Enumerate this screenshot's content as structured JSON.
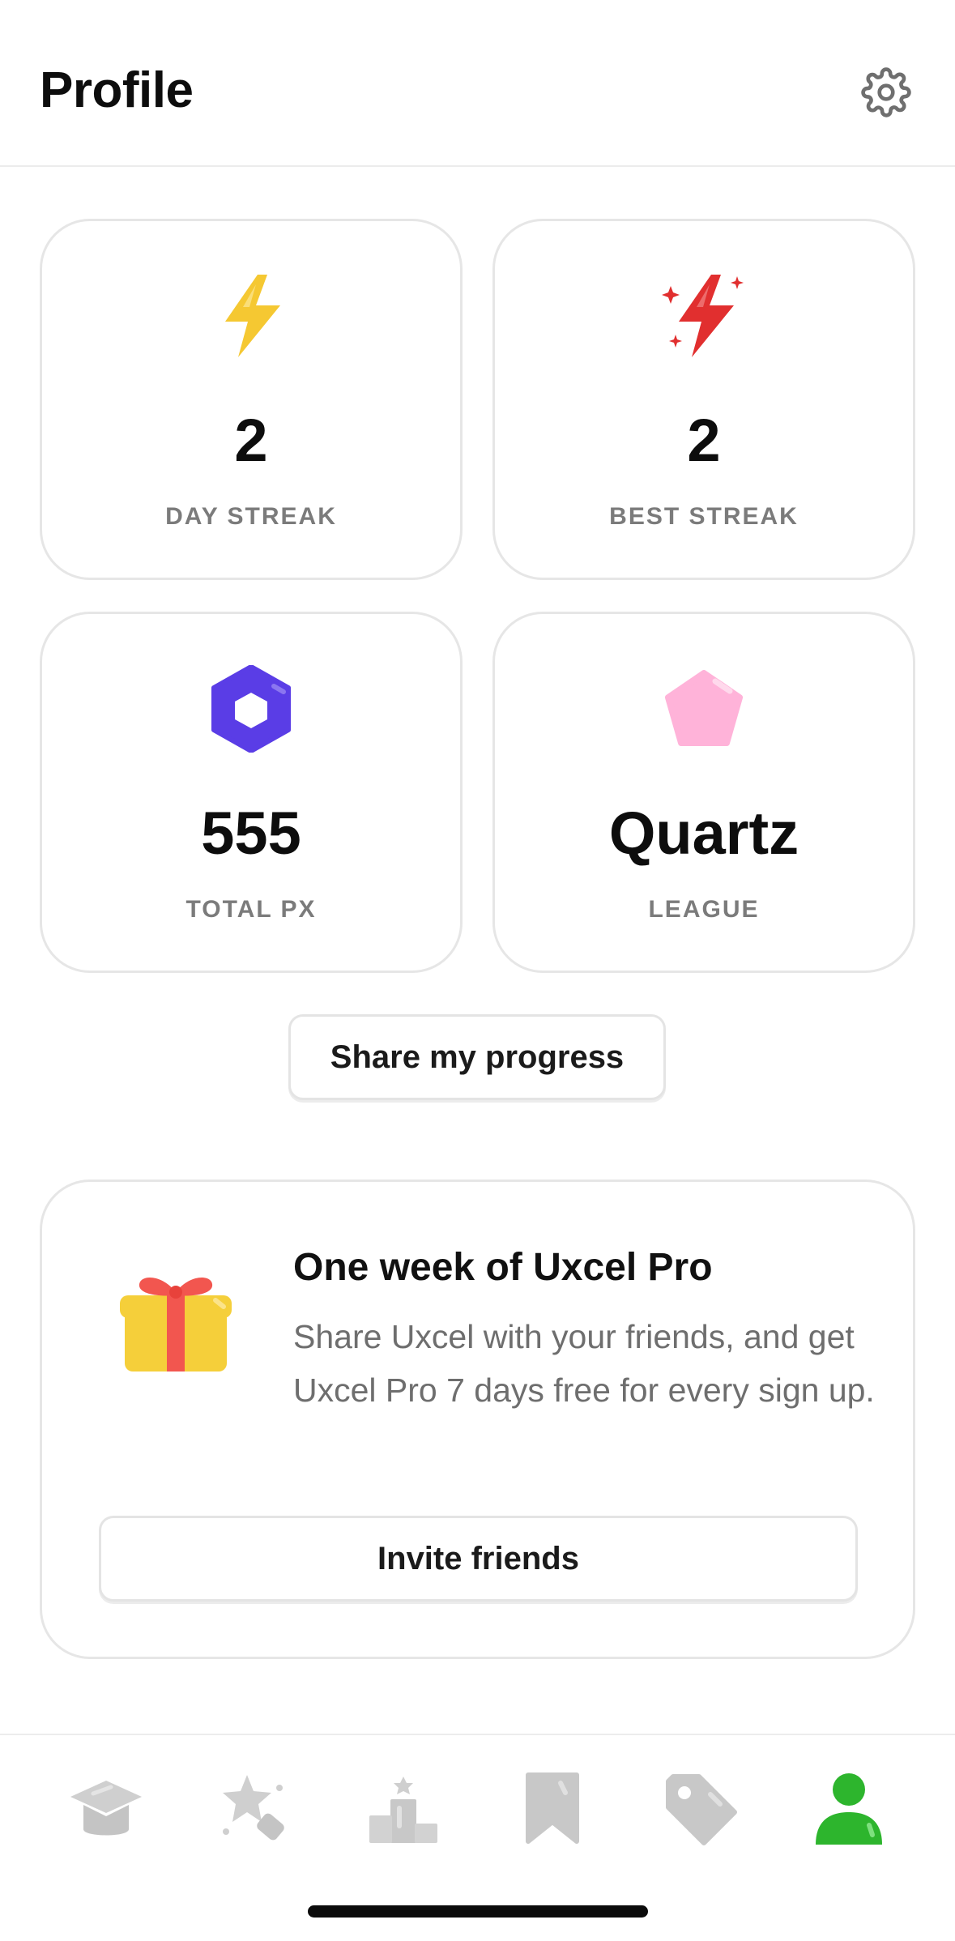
{
  "header": {
    "title": "Profile",
    "settings_icon": "gear-icon"
  },
  "stats": [
    {
      "value": "2",
      "label": "DAY STREAK",
      "icon": "lightning-icon",
      "color": "#f5c832"
    },
    {
      "value": "2",
      "label": "BEST STREAK",
      "icon": "lightning-sparkle-icon",
      "color": "#e12f2f"
    },
    {
      "value": "555",
      "label": "TOTAL PX",
      "icon": "hexagon-icon",
      "color": "#5a3de6"
    },
    {
      "value": "Quartz",
      "label": "LEAGUE",
      "icon": "pentagon-gem-icon",
      "color": "#ffb3d9"
    }
  ],
  "share_button": {
    "label": "Share my progress"
  },
  "promo": {
    "title": "One week of Uxcel Pro",
    "text": "Share Uxcel with your friends, and get Uxcel Pro 7 days free for every sign up.",
    "button_label": "Invite friends",
    "icon": "gift-icon"
  },
  "bottom_nav": {
    "items": [
      {
        "icon": "graduation-cap-icon",
        "active": false
      },
      {
        "icon": "star-tag-icon",
        "active": false
      },
      {
        "icon": "leaderboard-icon",
        "active": false
      },
      {
        "icon": "bookmark-icon",
        "active": false
      },
      {
        "icon": "price-tag-icon",
        "active": false
      },
      {
        "icon": "profile-icon",
        "active": true
      }
    ],
    "inactive_color": "#c8c8c8",
    "active_color": "#2db52d"
  }
}
